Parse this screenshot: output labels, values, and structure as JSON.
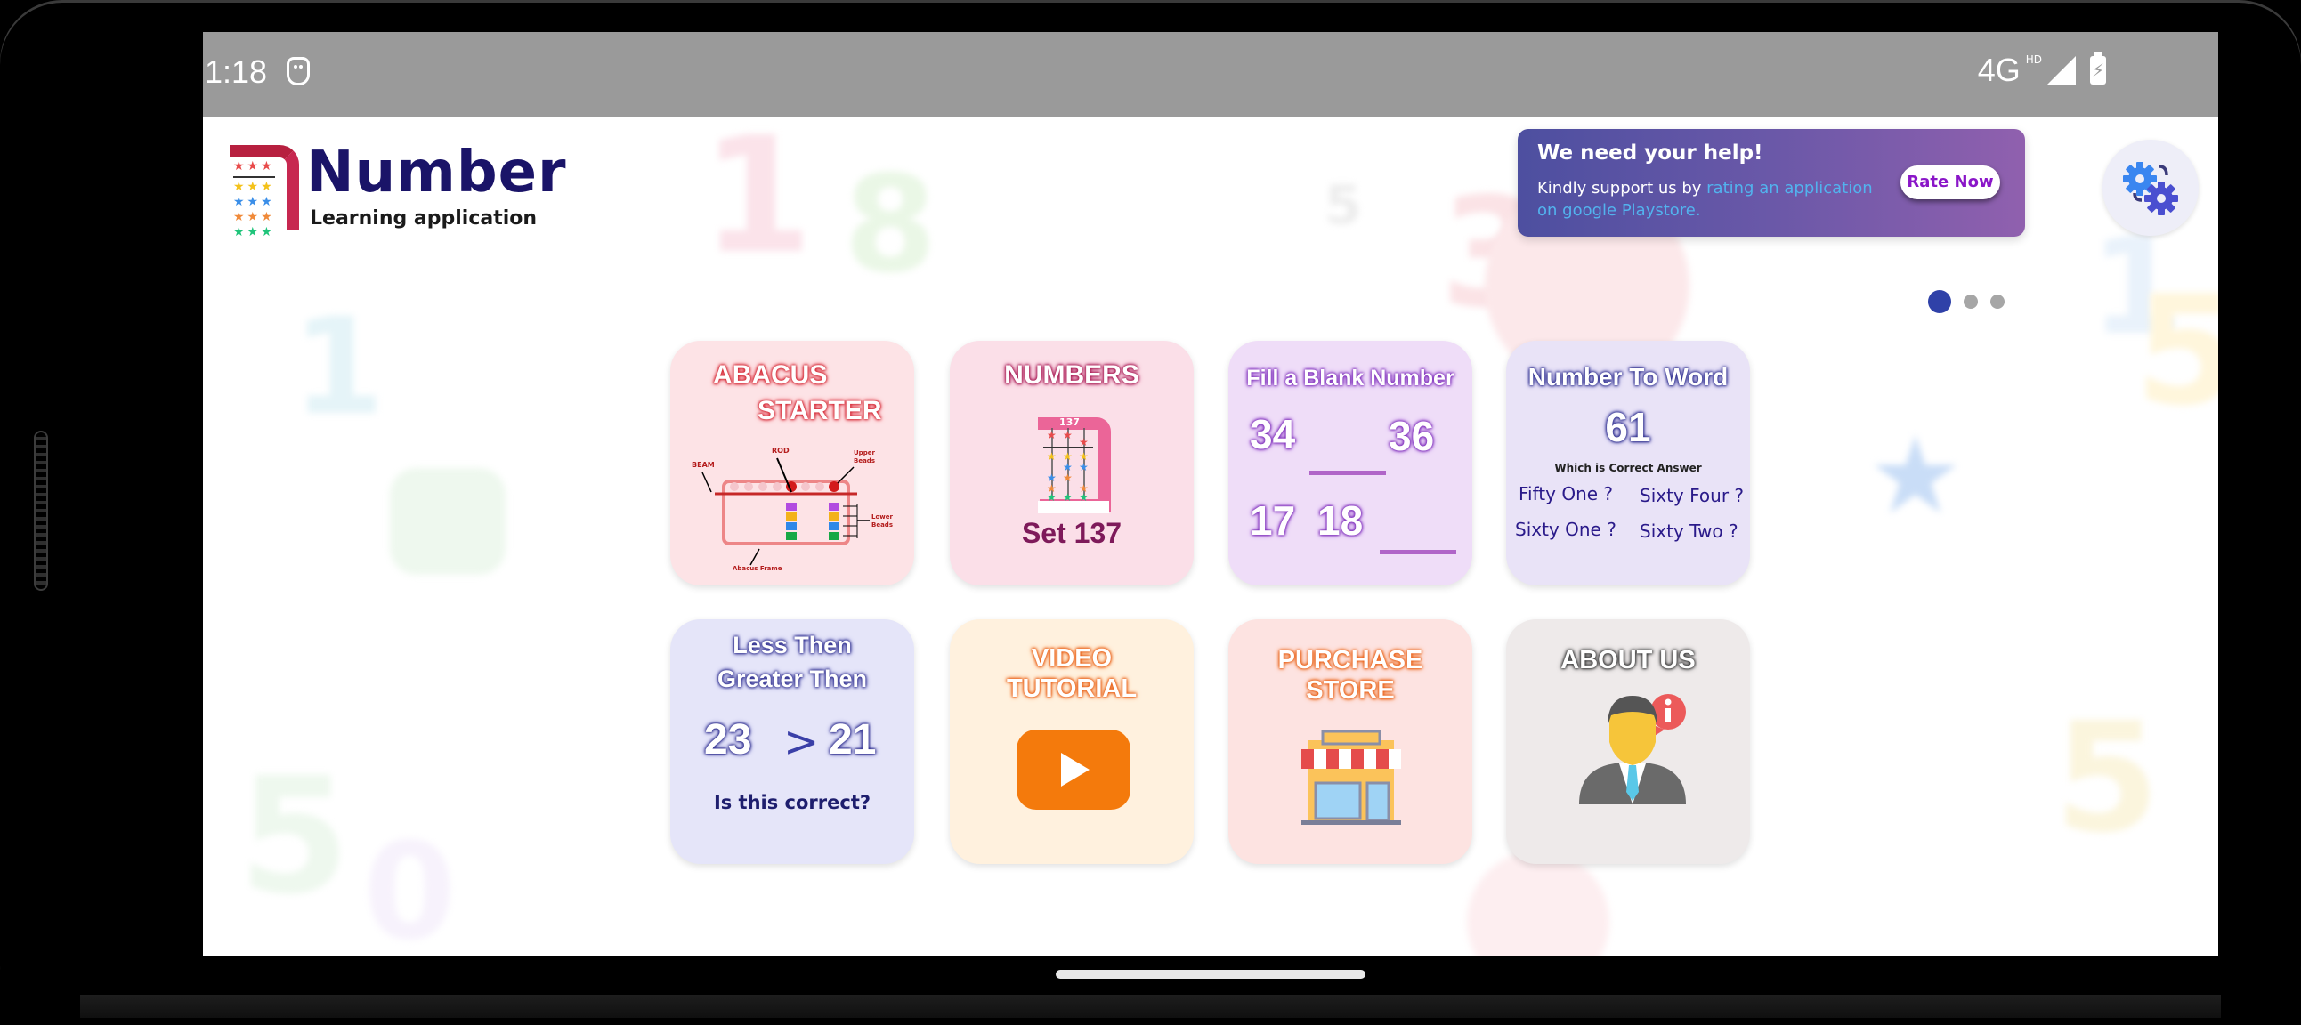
{
  "status_bar": {
    "time": "1:18",
    "network": "4G",
    "network_badge": "HD"
  },
  "app": {
    "logo_title": "Number",
    "logo_subtitle": "Learning application"
  },
  "promo": {
    "title": "We need your help!",
    "text_prefix": "Kindly support us by ",
    "text_link": "rating an application on google Playstore.",
    "button_label": "Rate Now"
  },
  "carousel": {
    "total": 3,
    "active_index": 0
  },
  "tiles": [
    {
      "title_line1": "ABACUS",
      "title_line2": "STARTER",
      "labels": {
        "beam": "BEAM",
        "rod": "ROD",
        "upper": "Upper Beads",
        "lower": "Lower Beads",
        "frame": "Abacus Frame"
      }
    },
    {
      "title": "NUMBERS",
      "abacus_value": "137",
      "caption": "Set 137"
    },
    {
      "title": "Fill a Blank Number",
      "row1_a": "34",
      "row1_b": "36",
      "row2_a": "17",
      "row2_b": "18"
    },
    {
      "title": "Number To Word",
      "number": "61",
      "question": "Which is Correct Answer",
      "options": [
        "Fifty One ?",
        "Sixty Four ?",
        "Sixty One ?",
        "Sixty Two ?"
      ]
    },
    {
      "title_line1": "Less Then",
      "title_line2": "Greater Then",
      "left": "23",
      "symbol": ">",
      "right": "21",
      "question": "Is this correct?"
    },
    {
      "title_line1": "VIDEO",
      "title_line2": "TUTORIAL"
    },
    {
      "title_line1": "PURCHASE",
      "title_line2": "STORE"
    },
    {
      "title": "ABOUT US"
    }
  ],
  "colors": {
    "brand_navy": "#1a1468",
    "active_dot": "#2f41a8",
    "rate_button_text": "#8a16c8",
    "play_orange": "#f47a0c"
  }
}
